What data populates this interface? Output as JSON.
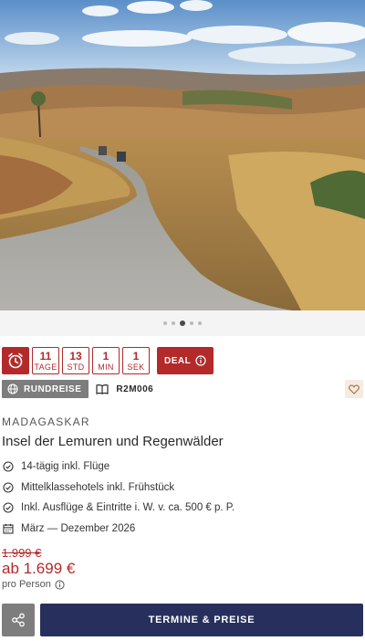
{
  "hero": {
    "image_alt": "Landstraße durch hügelige Savannenlandschaft",
    "slide_count": 5,
    "active_slide": 3
  },
  "countdown": {
    "icon": "alarm-clock-icon",
    "units": [
      {
        "value": "11",
        "label": "TAGE"
      },
      {
        "value": "13",
        "label": "STD"
      },
      {
        "value": "1",
        "label": "MIN"
      },
      {
        "value": "1",
        "label": "SEK"
      }
    ],
    "deal_label": "DEAL"
  },
  "tags": {
    "type_label": "RUNDREISE",
    "code": "R2M006"
  },
  "trip": {
    "country": "MADAGASKAR",
    "title": "Insel der Lemuren und Regenwälder",
    "features": [
      {
        "icon": "check-circle-icon",
        "text": "14-tägig inkl. Flüge"
      },
      {
        "icon": "check-circle-icon",
        "text": "Mittelklassehotels inkl. Frühstück"
      },
      {
        "icon": "check-circle-icon",
        "text": "Inkl. Ausflüge & Eintritte i. W. v. ca. 500 € p. P."
      },
      {
        "icon": "calendar-icon",
        "text": "März — Dezember 2026"
      }
    ]
  },
  "pricing": {
    "old_price": "1.999 €",
    "price": "ab 1.699 €",
    "per_person": "pro Person"
  },
  "actions": {
    "cta_label": "TERMINE & PREISE"
  },
  "colors": {
    "accent_red": "#b32a2a",
    "navy": "#27305c",
    "grey": "#7d7d7d"
  }
}
